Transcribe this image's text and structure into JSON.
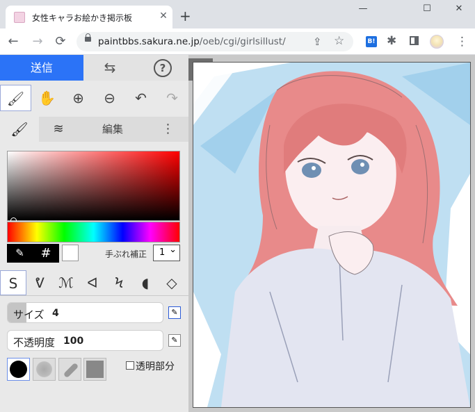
{
  "browser": {
    "tab_title": "女性キャラお絵かき掲示板",
    "tab_close": "✕",
    "new_tab": "+",
    "window_minimize": "—",
    "window_maximize": "☐",
    "window_close": "✕",
    "nav_back": "←",
    "nav_forward": "→",
    "nav_reload": "⟳",
    "url_host": "paintbbs.sakura.ne.jp",
    "url_path": "/oeb/cgi/girlsillust/",
    "bi_label": "B!",
    "share_glyph": "⇪",
    "star_glyph": "☆",
    "ext_glyph": "✱",
    "menu_glyph": "⋮"
  },
  "top_buttons": {
    "send": "送信",
    "swap": "⇆",
    "help": "?"
  },
  "tools": {
    "brush": "🖌",
    "hand": "✋",
    "zoom_in": "⊕",
    "zoom_out": "⊖",
    "undo": "↶",
    "redo": "↷"
  },
  "panel_tabs": {
    "pen": "🖌",
    "layer": "≋",
    "edit": "編集",
    "more": "⋮"
  },
  "color": {
    "hue_color": "#ff0000",
    "current": "#ffffff",
    "eyedropper": "✎",
    "hex": "#",
    "stabilizer_label": "手ぶれ補正",
    "stabilizer_value": "1"
  },
  "brush_types": [
    "S",
    "ᕓ",
    "ℳ",
    "ᐊ",
    "Ϟ",
    "◖",
    "◇"
  ],
  "size_slider": {
    "label": "サイズ",
    "value": "4",
    "fill_fraction": 0.12
  },
  "opacity_slider": {
    "label": "不透明度",
    "value": "100",
    "fill_fraction": 0.0
  },
  "pressure_glyph": "✎",
  "alpha_lock_label": "透明部分",
  "collapse_glyph": "⇤",
  "accent_color": "#2b73f7"
}
